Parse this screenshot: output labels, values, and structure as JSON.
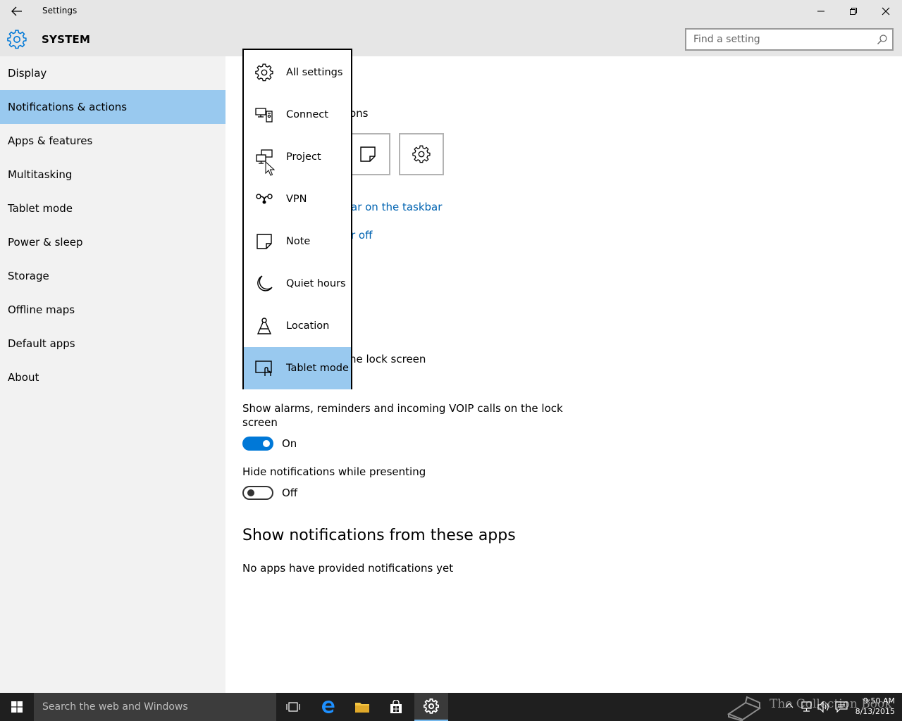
{
  "window": {
    "title": "Settings"
  },
  "header": {
    "section": "SYSTEM",
    "search_placeholder": "Find a setting"
  },
  "sidebar": {
    "items": [
      {
        "label": "Display"
      },
      {
        "label": "Notifications & actions",
        "active": true
      },
      {
        "label": "Apps & features"
      },
      {
        "label": "Multitasking"
      },
      {
        "label": "Tablet mode"
      },
      {
        "label": "Power & sleep"
      },
      {
        "label": "Storage"
      },
      {
        "label": "Offline maps"
      },
      {
        "label": "Default apps"
      },
      {
        "label": "About"
      }
    ]
  },
  "main": {
    "quick_actions_fragment": "ons",
    "link_taskbar_fragment": "ar on the taskbar",
    "link_onoff_fragment": "r off",
    "lock_screen_fragment": "he lock screen",
    "alarms_label_line1": "Show alarms, reminders and incoming VOIP calls on the lock",
    "alarms_label_line2": "screen",
    "alarms_state": "On",
    "hide_label": "Hide notifications while presenting",
    "hide_state": "Off",
    "apps_heading": "Show notifications from these apps",
    "apps_empty": "No apps have provided notifications yet"
  },
  "flyout": {
    "items": [
      {
        "label": "All settings",
        "icon": "gear-icon"
      },
      {
        "label": "Connect",
        "icon": "connect-icon"
      },
      {
        "label": "Project",
        "icon": "project-icon"
      },
      {
        "label": "VPN",
        "icon": "vpn-icon"
      },
      {
        "label": "Note",
        "icon": "note-icon"
      },
      {
        "label": "Quiet hours",
        "icon": "moon-icon"
      },
      {
        "label": "Location",
        "icon": "location-icon"
      },
      {
        "label": "Tablet mode",
        "icon": "tablet-mode-icon",
        "selected": true
      }
    ]
  },
  "taskbar": {
    "search_placeholder": "Search the web and Windows",
    "time": "9:50 AM",
    "date": "8/13/2015",
    "watermark": "The Collection Book"
  },
  "colors": {
    "accent": "#0078d7",
    "selection": "#99c9ef",
    "link": "#0063b1"
  }
}
